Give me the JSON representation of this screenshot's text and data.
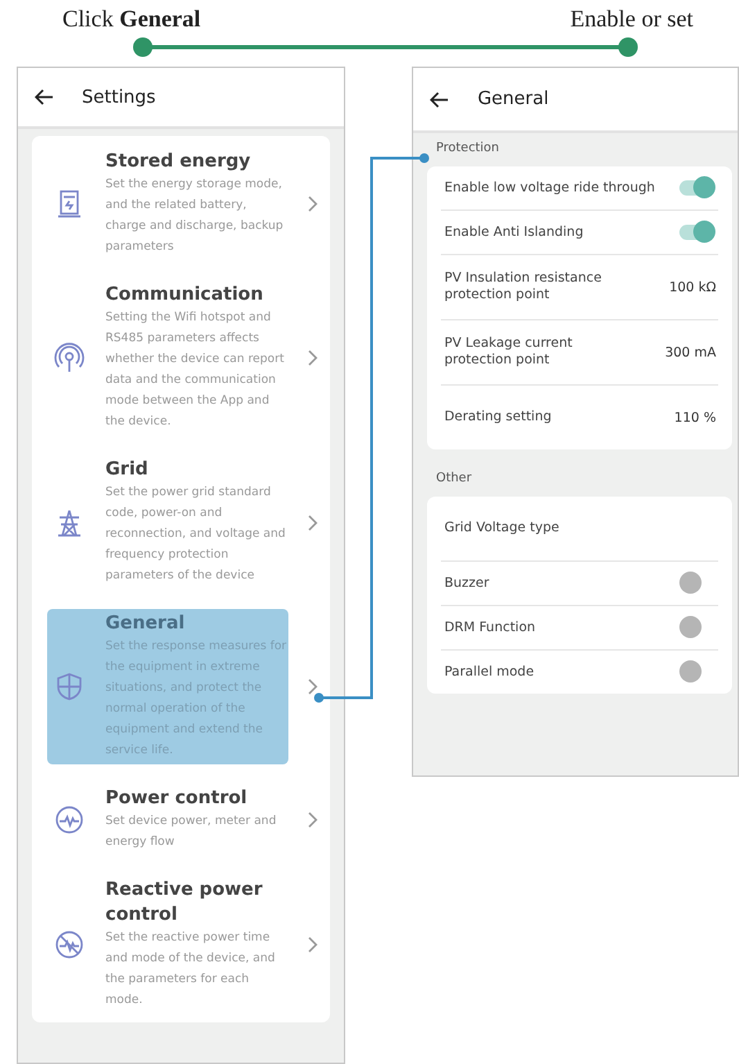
{
  "annotation": {
    "left_label": "Click **General**",
    "right_label": "Enable or set"
  },
  "settings_screen": {
    "title": "Settings",
    "items": [
      {
        "title": "Stored energy",
        "description": "Set the energy storage mode, and the related battery, charge and discharge, backup parameters",
        "selected": false
      },
      {
        "title": "Communication",
        "description": "Setting the Wifi hotspot and RS485 parameters affects whether the device can report data and the communication mode between the App and the device.",
        "selected": false
      },
      {
        "title": "Grid",
        "description": "Set the power grid standard code, power-on and reconnection, and voltage and frequency protection parameters of the device",
        "selected": false
      },
      {
        "title": "General",
        "description": "Set the response measures for the equipment in extreme situations, and protect the normal operation of the equipment and extend the service life.",
        "selected": true
      },
      {
        "title": "Power control",
        "description": "Set device power, meter and energy flow",
        "selected": false
      },
      {
        "title": "Reactive power control",
        "description": "Set the reactive power time and mode of the device, and the parameters for each mode.",
        "selected": false
      }
    ]
  },
  "general_screen": {
    "title": "General",
    "sections": [
      {
        "title": "Protection",
        "rows": [
          {
            "kind": "toggle",
            "label": "Enable low voltage ride through",
            "on": true
          },
          {
            "kind": "toggle",
            "label": "Enable Anti Islanding",
            "on": true
          },
          {
            "kind": "value",
            "label": "PV Insulation resistance protection point",
            "value": "100 kΩ"
          },
          {
            "kind": "value",
            "label": "PV Leakage current protection point",
            "value": "300 mA"
          },
          {
            "kind": "value",
            "label": "Derating setting",
            "value": "110 %"
          }
        ]
      },
      {
        "title": "Other",
        "rows": [
          {
            "kind": "plain",
            "label": "Grid Voltage type"
          },
          {
            "kind": "toggle",
            "label": "Buzzer",
            "on": false
          },
          {
            "kind": "toggle",
            "label": "DRM Function",
            "on": false
          },
          {
            "kind": "toggle",
            "label": "Parallel mode",
            "on": false
          }
        ]
      }
    ]
  }
}
